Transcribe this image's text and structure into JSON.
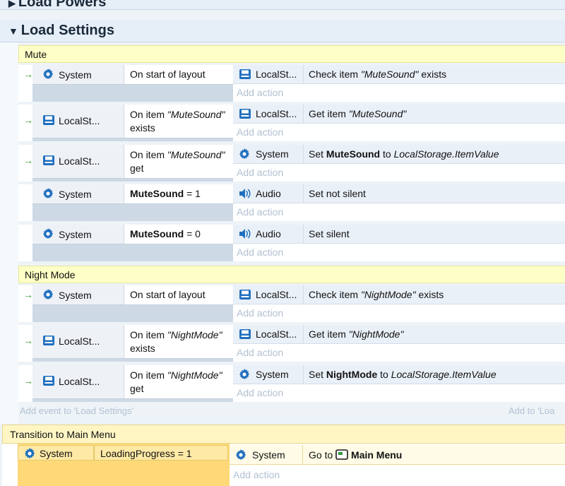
{
  "groups": {
    "load_powers": {
      "title": "Load Powers",
      "arrow": "▶"
    },
    "load_settings": {
      "title": "Load Settings",
      "arrow": "▼"
    }
  },
  "subgroups": {
    "mute": "Mute",
    "night_mode": "Night Mode",
    "transition": "Transition to Main Menu"
  },
  "labels": {
    "add_action": "Add action",
    "add_event": "Add event to 'Load Settings'",
    "add_to": "Add to 'Loa",
    "system": "System",
    "localst": "LocalSt...",
    "audio": "Audio"
  },
  "events": [
    {
      "arrow": "→",
      "cond_obj": "System",
      "cond_text": "On start of layout",
      "act_obj": "LocalSt...",
      "act_pre": "Check item ",
      "act_em": "\"MuteSound\"",
      "act_post": " exists"
    },
    {
      "arrow": "→",
      "cond_obj": "LocalSt...",
      "cond_pre": "On item ",
      "cond_em": "\"MuteSound\"",
      "cond_post": "exists",
      "act_obj": "LocalSt...",
      "act_pre": "Get item ",
      "act_em": "\"MuteSound\""
    },
    {
      "arrow": "→",
      "cond_obj": "LocalSt...",
      "cond_pre": "On item ",
      "cond_em": "\"MuteSound\"",
      "cond_post": "get",
      "act_obj": "System",
      "act_pre": "Set ",
      "act_b": "MuteSound",
      "act_mid": " to ",
      "act_em": "LocalStorage.ItemValue"
    },
    {
      "cond_obj": "System",
      "cond_b": "MuteSound",
      "cond_text": " = 1",
      "act_obj": "Audio",
      "act_text": "Set not silent"
    },
    {
      "cond_obj": "System",
      "cond_b": "MuteSound",
      "cond_text": " = 0",
      "act_obj": "Audio",
      "act_text": "Set silent"
    },
    {
      "arrow": "→",
      "cond_obj": "System",
      "cond_text": "On start of layout",
      "act_obj": "LocalSt...",
      "act_pre": "Check item ",
      "act_em": "\"NightMode\"",
      "act_post": " exists"
    },
    {
      "arrow": "→",
      "cond_obj": "LocalSt...",
      "cond_pre": "On item ",
      "cond_em": "\"NightMode\"",
      "cond_post": "exists",
      "act_obj": "LocalSt...",
      "act_pre": "Get item ",
      "act_em": "\"NightMode\""
    },
    {
      "arrow": "→",
      "cond_obj": "LocalSt...",
      "cond_pre": "On item ",
      "cond_em": "\"NightMode\"",
      "cond_post": "get",
      "act_obj": "System",
      "act_pre": "Set ",
      "act_b": "NightMode",
      "act_mid": " to ",
      "act_em": "LocalStorage.ItemValue"
    }
  ],
  "transition_event": {
    "cond_obj": "System",
    "cond_text": "LoadingProgress = 1",
    "act_obj": "System",
    "act_pre": "Go to ",
    "act_b": "Main Menu"
  },
  "icons": {
    "system": "gear-icon",
    "localst": "local-storage-icon",
    "audio": "speaker-icon",
    "layout": "layout-icon"
  },
  "colors": {
    "group_bg": "#e6eef8",
    "subgroup_bg": "#feffc6",
    "transition_bg": "#fff6c4",
    "trans_cond_bg": "#ffd978",
    "icon_blue": "#1f6fbf",
    "arrow_green": "#3b9a2f",
    "add_action_text": "#b2c1d2"
  }
}
